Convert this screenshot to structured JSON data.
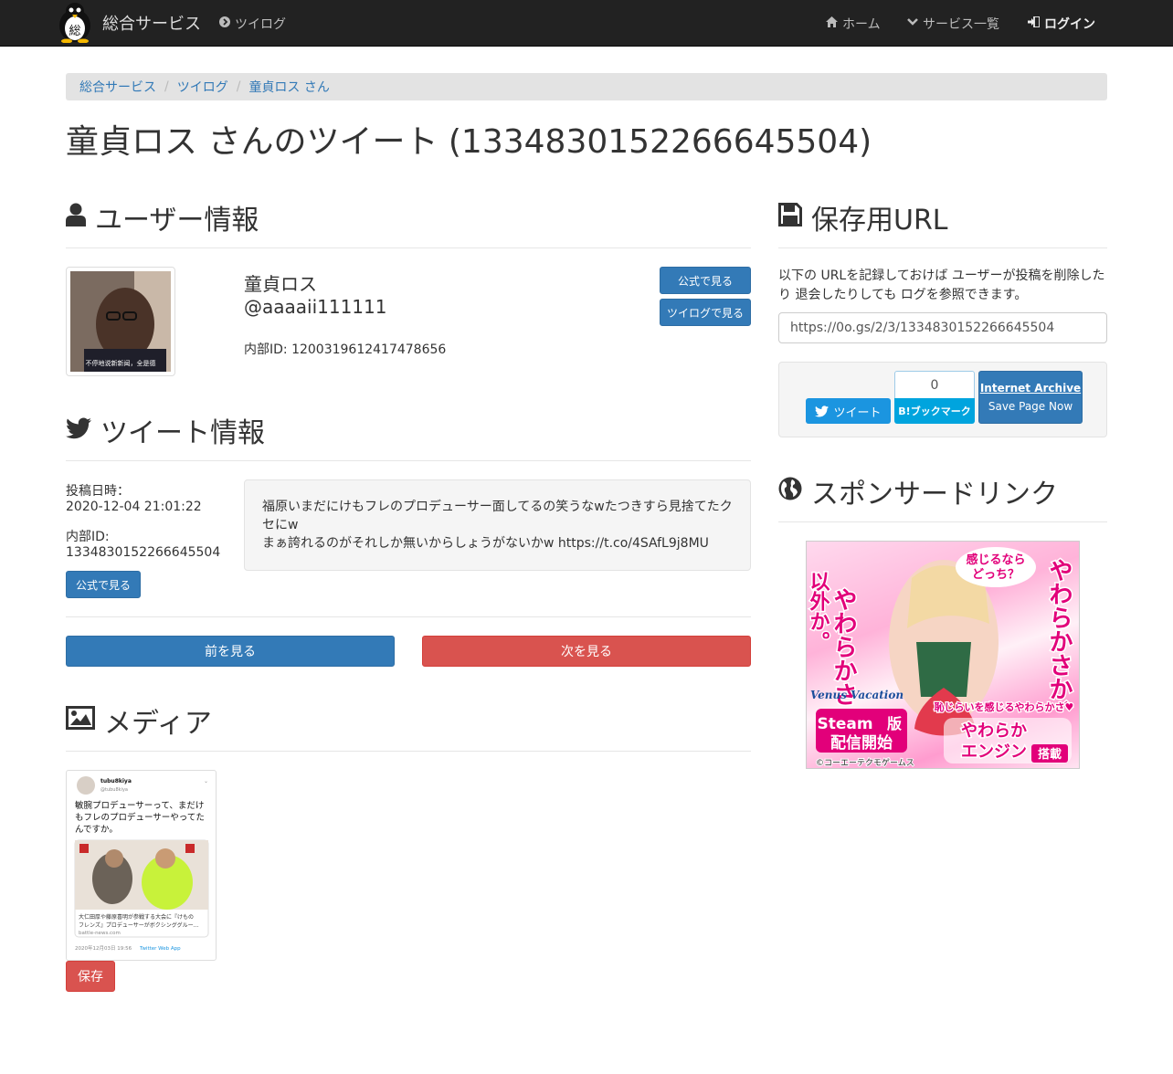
{
  "navbar": {
    "brand": "総合サービス",
    "logo_char": "総",
    "twilog_link": "ツイログ",
    "home": "ホーム",
    "services": "サービス一覧",
    "login": "ログイン"
  },
  "breadcrumb": [
    "総合サービス",
    "ツイログ",
    "童貞ロス さん"
  ],
  "page_title": "童貞ロス さんのツイート (1334830152266645504)",
  "user_section": {
    "heading": "ユーザー情報",
    "name": "童貞ロス",
    "handle": "@aaaaii111111",
    "internal_id": "内部ID: 1200319612417478656",
    "avatar_caption": "不停地说新新闻，全是德",
    "btn_official": "公式で見る",
    "btn_twilog": "ツイログで見る"
  },
  "tweet_section": {
    "heading": "ツイート情報",
    "posted_label": "投稿日時：",
    "posted_value": "2020-12-04 21:01:22",
    "id_label": "内部ID:",
    "id_value": "1334830152266645504",
    "btn_official": "公式で見る",
    "text_line1": "福原いまだにけもフレのプロデューサー面してるの笑うなwたつきすら見捨てたク",
    "text_line2": "セにw",
    "text_line3": "まぁ誇れるのがそれしか無いからしょうがないかw https://t.co/4SAfL9j8MU",
    "btn_prev": "前を見る",
    "btn_next": "次を見る"
  },
  "media_section": {
    "heading": "メディア",
    "thumb_user": "tubu8kiya",
    "thumb_handle": "@tubu8kiya",
    "thumb_text1": "敏腕プロデューサーって、まだけ",
    "thumb_text2": "もフレのプロデューサーやってた",
    "thumb_text3": "んですか。",
    "thumb_link1": "大仁田厚や藤原喜明が参戦する大会に『けもの",
    "thumb_link2": "フレンズ』プロデューサーがボクシンググルー…",
    "thumb_domain": "battle-news.com",
    "thumb_date": "2020年12月03日 19:56",
    "thumb_via": "Twitter Web App",
    "btn_save": "保存"
  },
  "save_section": {
    "heading": "保存用URL",
    "desc": "以下の URLを記録しておけば ユーザーが投稿を削除したり 退会したりしても ログを参照できます。",
    "url": "https://0o.gs/2/3/1334830152266645504",
    "tweet_btn": "ツイート",
    "hb_count": "0",
    "hb_btn": "B!ブックマーク",
    "ia_title": "Internet Archive",
    "ia_sub": "Save Page Now"
  },
  "sponsor_section": {
    "heading": "スポンサードリンク",
    "ad_text1": "やわらかさ",
    "ad_text2": "以外か。",
    "ad_text3": "やわらかさか、",
    "ad_bubble1": "感じるなら",
    "ad_bubble2": "どっち？",
    "ad_logo": "Venus Vacation",
    "ad_steam1": "Steam",
    "ad_steam2": "版",
    "ad_steam3": "配信開始",
    "ad_sub": "恥じらいを感じるやわらかさ♥",
    "ad_engine1": "やわらか",
    "ad_engine2": "エンジン",
    "ad_engine3": "搭載",
    "ad_copy": "©コーエーテクモゲームス"
  },
  "colors": {
    "primary": "#337ab7",
    "danger": "#d9534f",
    "navbar": "#222222",
    "twitter": "#1b95e0",
    "hatena": "#00a4de"
  }
}
